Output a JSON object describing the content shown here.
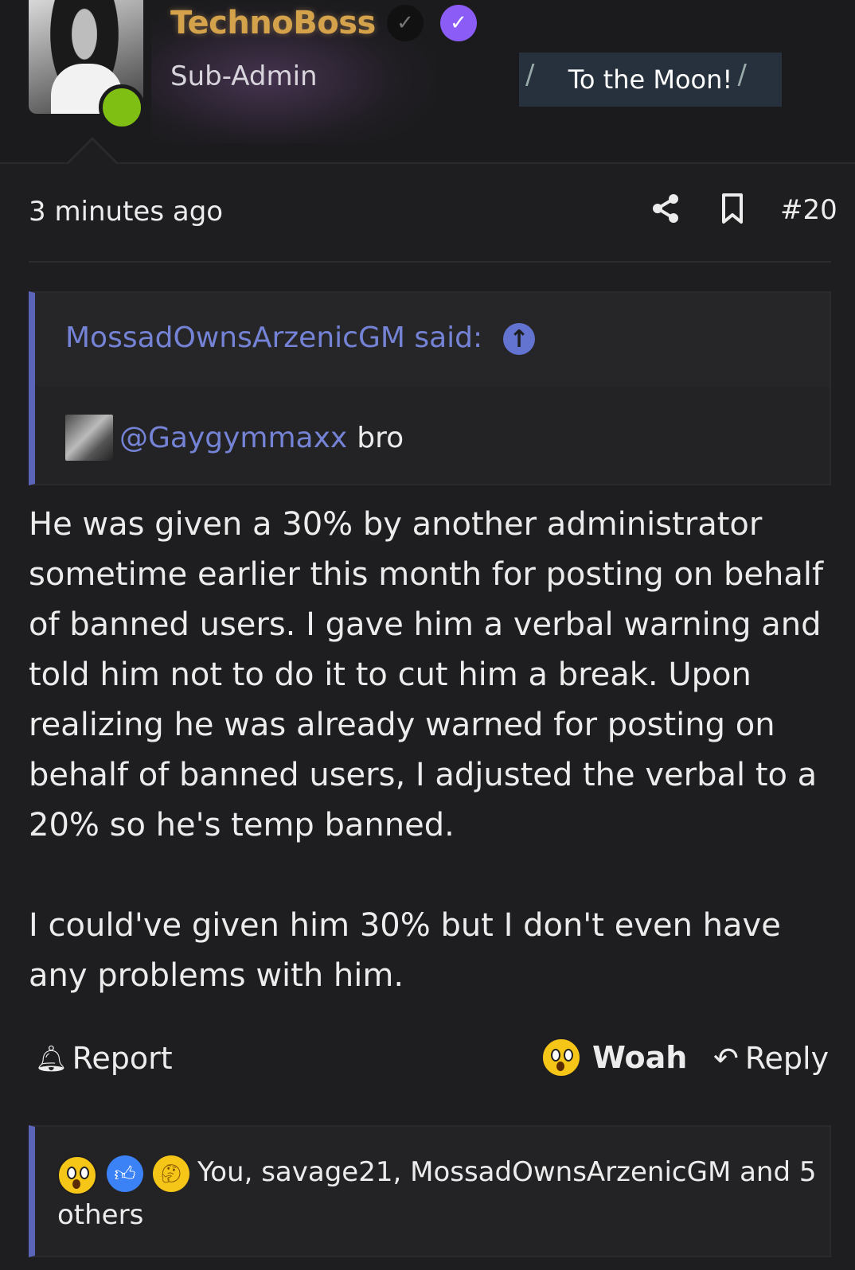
{
  "header": {
    "username": "TechnoBoss",
    "role": "Sub-Admin",
    "user_title": "To the Moon!"
  },
  "post": {
    "timestamp": "3 minutes ago",
    "number": "#20",
    "quote": {
      "author": "MossadOwnsArzenicGM said:",
      "mention": "@Gaygymmaxx",
      "text": "bro"
    },
    "paragraphs": [
      "He was given a 30% by another administrator sometime earlier this month for posting on behalf of banned users. I gave him a verbal warning and told him not to do it to cut him a break. Upon realizing he was already warned for posting on behalf of banned users, I adjusted the verbal to a 20% so he's temp banned.",
      "I could've given him 30% but I don't even have any problems with him."
    ]
  },
  "actions": {
    "report": "Report",
    "woah": "Woah",
    "reply": "Reply"
  },
  "reactions": {
    "summary": "You, savage21, MossadOwnsArzenicGM and 5 others",
    "icons": [
      "astonished-emoji",
      "like-emoji",
      "thinking-emoji"
    ]
  },
  "colors": {
    "accent": "#5a64b8",
    "link": "#7583d6",
    "verified": "#8b5cf6",
    "online": "#7fbf14",
    "username": "#d4a24a"
  }
}
